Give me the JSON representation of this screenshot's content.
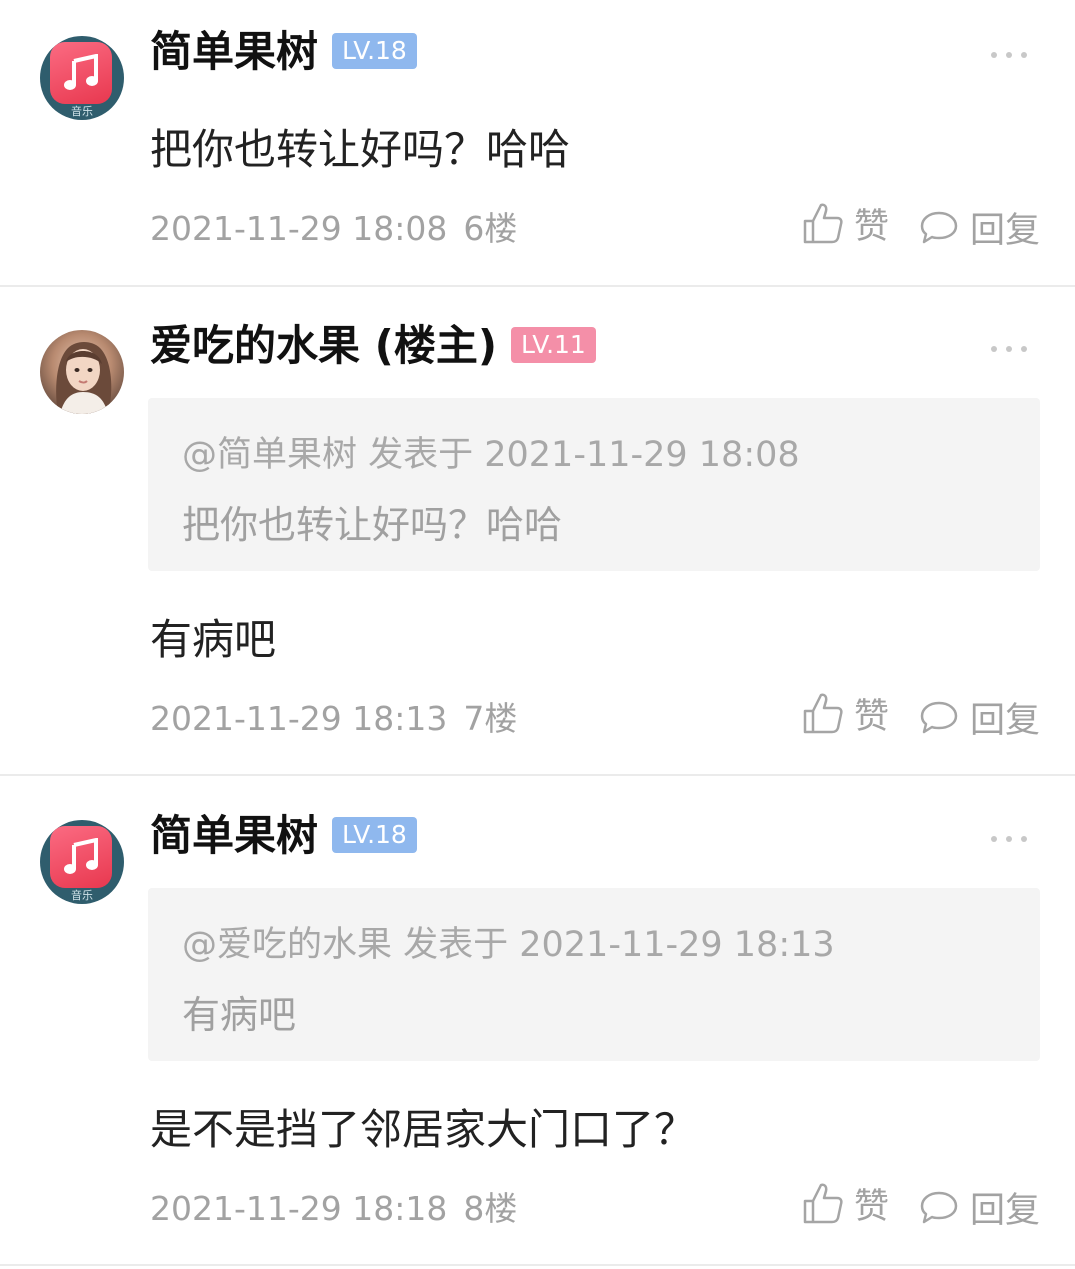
{
  "comments": [
    {
      "username": "简单果树",
      "level": "LV.18",
      "avatar_label": "音乐",
      "quote": null,
      "content": "把你也转让好吗？哈哈",
      "timestamp": "2021-11-29 18:08",
      "floor": "6楼",
      "like_label": "赞",
      "reply_label": "回复"
    },
    {
      "username": "爱吃的水果 (楼主)",
      "level": "LV.11",
      "quote": {
        "meta": "@简单果树 发表于 2021-11-29 18:08",
        "text": "把你也转让好吗？哈哈"
      },
      "content": "有病吧",
      "timestamp": "2021-11-29 18:13",
      "floor": "7楼",
      "like_label": "赞",
      "reply_label": "回复"
    },
    {
      "username": "简单果树",
      "level": "LV.18",
      "avatar_label": "音乐",
      "quote": {
        "meta": "@爱吃的水果 发表于 2021-11-29 18:13",
        "text": "有病吧"
      },
      "content": "是不是挡了邻居家大门口了？",
      "timestamp": "2021-11-29 18:18",
      "floor": "8楼",
      "like_label": "赞",
      "reply_label": "回复"
    }
  ],
  "colors": {
    "badge_blue": "#8fb8ee",
    "badge_pink": "#f48fa8",
    "muted_text": "#a2a2a2",
    "quote_bg": "#f4f4f4"
  }
}
